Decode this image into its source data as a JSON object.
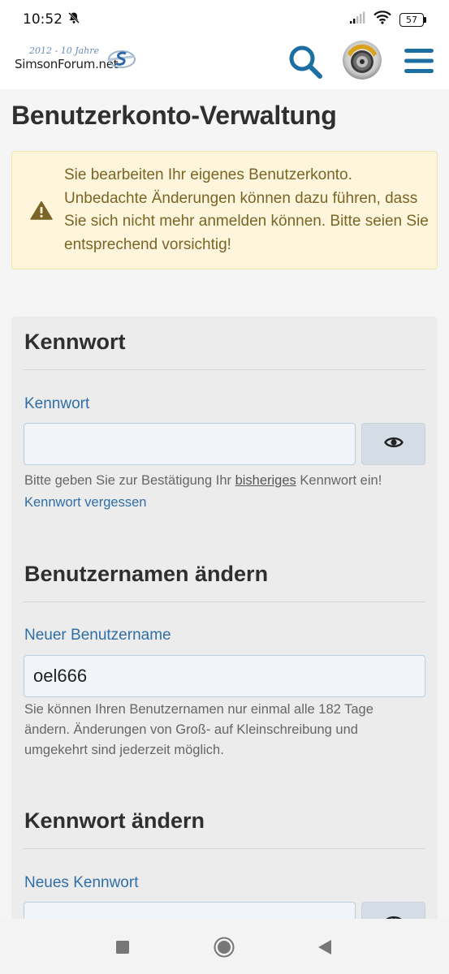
{
  "status_bar": {
    "time": "10:52",
    "battery": "57",
    "icons": [
      "bell-off-icon",
      "signal-icon",
      "wifi-icon",
      "battery-icon"
    ]
  },
  "header": {
    "logo": {
      "tagline": "2012 - 10 Jahre",
      "name": "SimsonForum",
      "tld": ".net"
    },
    "icons": [
      "search-icon",
      "avatar",
      "menu-icon"
    ]
  },
  "page": {
    "title": "Benutzerkonto-Verwaltung"
  },
  "warning": {
    "icon": "warning-icon",
    "text": "Sie bearbeiten Ihr eigenes Benutzerkonto. Unbedachte Änderungen können dazu führen, dass Sie sich nicht mehr anmelden können. Bitte seien Sie entsprechend vorsichtig!"
  },
  "sections": {
    "password": {
      "title": "Kennwort",
      "label": "Kennwort",
      "value": "",
      "hint_before": "Bitte geben Sie zur Bestätigung Ihr ",
      "hint_underlined": "bisheriges",
      "hint_after": " Kennwort ein!",
      "forgot_link": "Kennwort vergessen"
    },
    "username": {
      "title": "Benutzernamen ändern",
      "label": "Neuer Benutzername",
      "value": "oel666",
      "hint": "Sie können Ihren Benutzernamen nur einmal alle 182 Tage ändern. Änderungen von Groß- auf Kleinschreibung und umgekehrt sind jederzeit möglich."
    },
    "change_password": {
      "title": "Kennwort ändern",
      "label": "Neues Kennwort",
      "value": ""
    }
  },
  "nav_bar": {
    "buttons": [
      "recents-button",
      "home-button",
      "back-button"
    ]
  },
  "colors": {
    "accent": "#2f6ea6",
    "header_icon": "#1d6fa3",
    "warning_bg": "#fdf6dc",
    "warning_text": "#7a6526",
    "panel_bg": "#ececec"
  }
}
